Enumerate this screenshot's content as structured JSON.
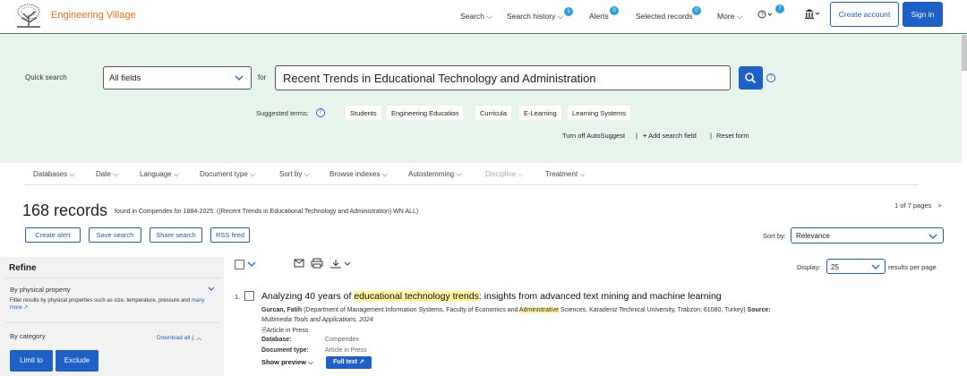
{
  "header": {
    "brand": "Engineering Village",
    "nav": [
      {
        "label": "Search",
        "badge": null
      },
      {
        "label": "Search history",
        "badge": "1"
      },
      {
        "label": "Alerts",
        "badge": "0"
      },
      {
        "label": "Selected records",
        "badge": "0"
      },
      {
        "label": "More",
        "badge": null
      }
    ],
    "help_badge": "7",
    "create_account": "Create account",
    "sign_in": "Sign in"
  },
  "search": {
    "quick_search_label": "Quick search",
    "field_select": "All fields",
    "for_label": "for",
    "query": "Recent Trends  in Educational  Technology and  Administration",
    "help": "?",
    "suggested_label": "Suggested terms:",
    "suggested_terms": [
      "Students",
      "Engineering Education",
      "Curricula",
      "E-Learning",
      "Learning Systems"
    ],
    "autosuggest": "Turn off AutoSuggest",
    "separator": "|",
    "add_field": "Add search field",
    "reset": "Reset form"
  },
  "filters": [
    {
      "label": "Databases",
      "disabled": false
    },
    {
      "label": "Date",
      "disabled": false
    },
    {
      "label": "Language",
      "disabled": false
    },
    {
      "label": "Document type",
      "disabled": false
    },
    {
      "label": "Sort by",
      "disabled": false
    },
    {
      "label": "Browse indexes",
      "disabled": false
    },
    {
      "label": "Autostemming",
      "disabled": false
    },
    {
      "label": "Discipline",
      "disabled": true
    },
    {
      "label": "Treatment",
      "disabled": false
    }
  ],
  "results": {
    "count": "168 records",
    "found_text": "found in Compendex for 1884-2025: ((Recent Trends in Educational Technology and Administration) WN ALL)",
    "pages": "1 of 7 pages",
    "actions": [
      "Create alert",
      "Save search",
      "Share search",
      "RSS feed"
    ],
    "sort_label": "Sort by:",
    "sort_value": "Relevance",
    "display_label": "Display:",
    "display_value": "25",
    "per_page": "results per page"
  },
  "refine": {
    "title": "Refine",
    "physical_heading": "By physical property",
    "physical_desc": "Filter results by physical properties such as size, temperature, pressure and",
    "more": "many more",
    "category_heading": "By category",
    "download_all": "Download all",
    "limit": "Limit to",
    "exclude": "Exclude"
  },
  "record": {
    "number": "1.",
    "title_pre": "Analyzing 40 years of ",
    "title_hl": "educational technology trends",
    "title_post": ": insights from advanced text mining and machine learning",
    "author": "Gurcan, Fatih",
    "affil_pre": "(Department of Management Information Systems, Faculty of Economics and ",
    "affil_hl": "Administrative",
    "affil_post": " Sciences, Karadeniz Technical University, Trabzon; 61080, Turkey)",
    "source_label": "Source:",
    "source": "Multimedia Tools and Applications, 2024",
    "press": "Article in Press",
    "database_label": "Database:",
    "database": "Compendex",
    "doctype_label": "Document type:",
    "doctype": "Article in Press",
    "preview": "Show preview",
    "full_text": "Full text"
  }
}
